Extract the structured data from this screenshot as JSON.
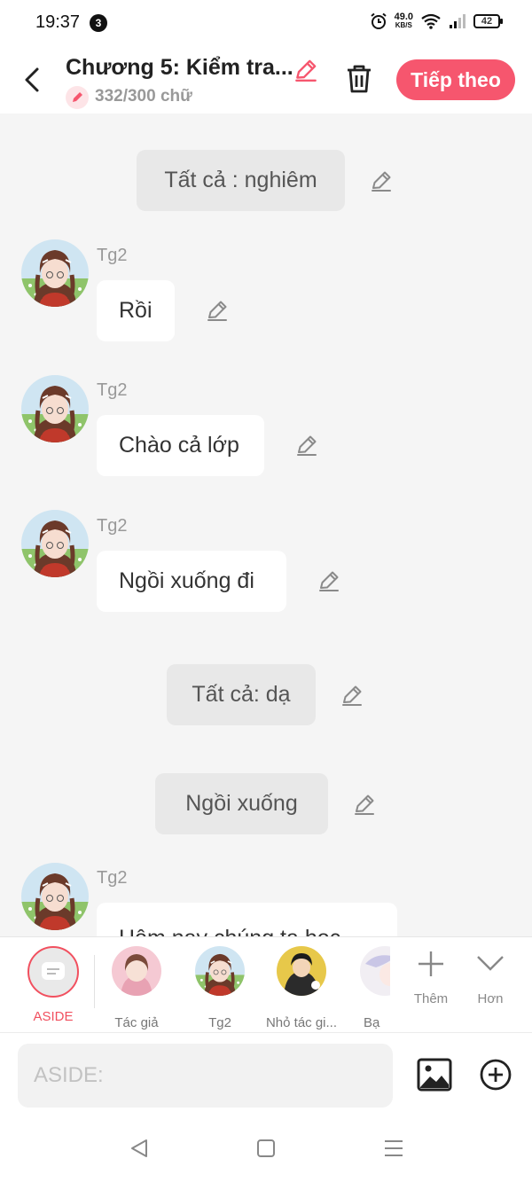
{
  "status_bar": {
    "time": "19:37",
    "notification_count": "3",
    "net_speed": "49.0",
    "net_speed_unit": "KB/S",
    "battery": "42"
  },
  "header": {
    "title": "Chương 5: Kiểm tra...",
    "word_count": "332/300 chữ",
    "next_label": "Tiếp theo",
    "accent": "#f6566e"
  },
  "messages": [
    {
      "type": "narration",
      "text": "Tất cả : nghiêm"
    },
    {
      "type": "dialogue",
      "speaker": "Tg2",
      "text": "Rồi"
    },
    {
      "type": "dialogue",
      "speaker": "Tg2",
      "text": "Chào cả lớp"
    },
    {
      "type": "dialogue",
      "speaker": "Tg2",
      "text": "Ngồi xuống đi"
    },
    {
      "type": "narration",
      "text": "Tất cả: dạ"
    },
    {
      "type": "narration",
      "text": "Ngồi xuống"
    },
    {
      "type": "dialogue",
      "speaker": "Tg2",
      "text": "Hôm nay chúng ta học"
    }
  ],
  "characters": [
    {
      "label": "ASIDE",
      "selected": true
    },
    {
      "label": "Tác giả"
    },
    {
      "label": "Tg2"
    },
    {
      "label": "Nhỏ tác gi..."
    },
    {
      "label": "Bạ"
    }
  ],
  "more": {
    "add_label": "Thêm",
    "more_label": "Hơn"
  },
  "composer": {
    "placeholder": "ASIDE:"
  }
}
